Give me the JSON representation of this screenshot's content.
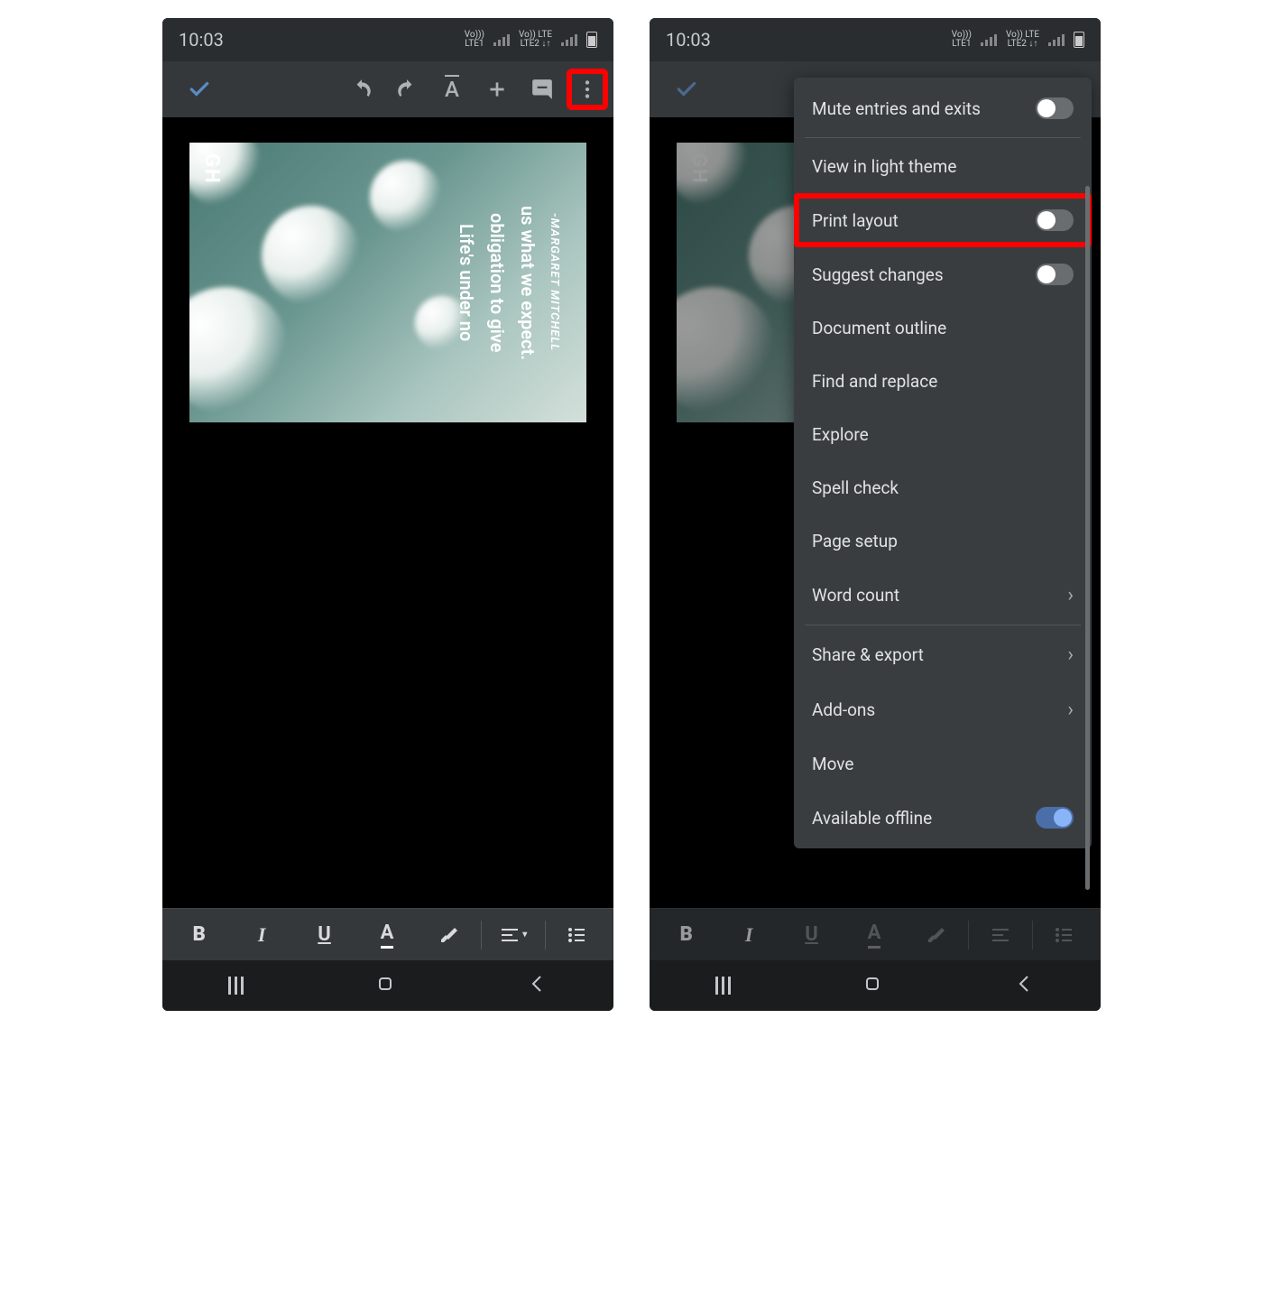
{
  "status": {
    "time": "10:03",
    "net1_top": "Vo)))",
    "net1_bot": "LTE1",
    "net2_top": "Vo)) LTE",
    "net2_bot": "LTE2 ↓↑"
  },
  "document": {
    "badge": "GH",
    "quote_l1": "Life's under no",
    "quote_l2": "obligation to give",
    "quote_l3": "us what we expect.",
    "author": "-MARGARET MITCHELL"
  },
  "menu": {
    "mute": "Mute entries and exits",
    "light_theme": "View in light theme",
    "print_layout": "Print layout",
    "suggest": "Suggest changes",
    "outline": "Document outline",
    "find": "Find and replace",
    "explore": "Explore",
    "spell": "Spell check",
    "page_setup": "Page setup",
    "word_count": "Word count",
    "share": "Share & export",
    "addons": "Add-ons",
    "move": "Move",
    "offline": "Available offline"
  },
  "format": {
    "bold": "B",
    "italic": "I",
    "underline": "U",
    "color": "A"
  }
}
